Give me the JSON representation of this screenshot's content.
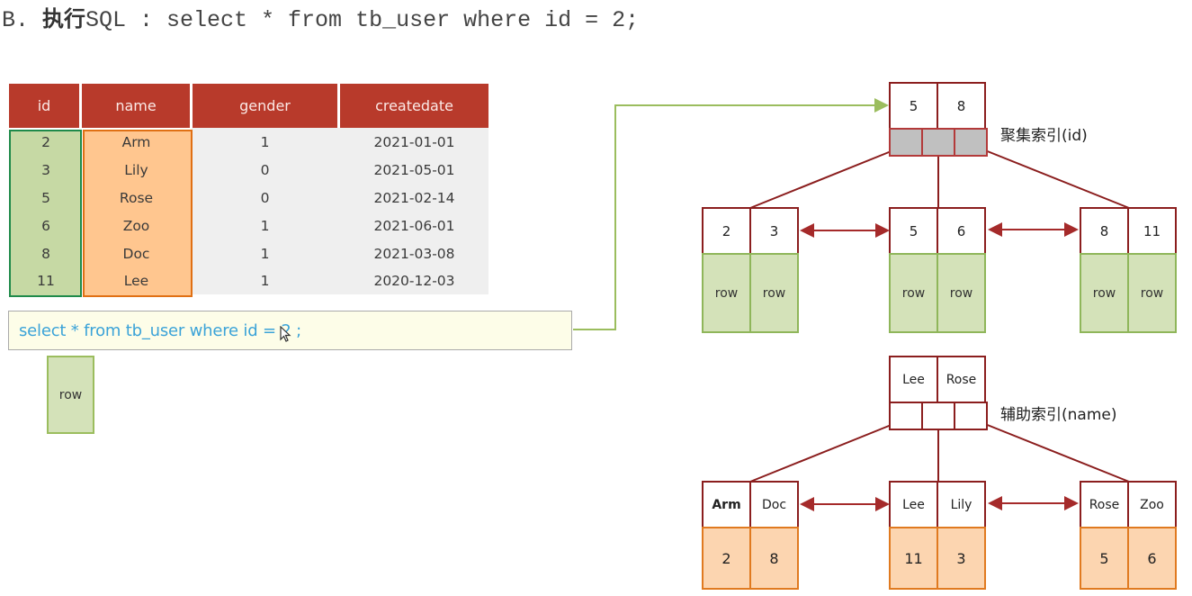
{
  "heading": {
    "prefix": "B. ",
    "cjk": "执行",
    "rest": "SQL : select * from tb_user where id = 2;"
  },
  "table": {
    "columns": [
      "id",
      "name",
      "gender",
      "createdate"
    ],
    "rows": [
      [
        "2",
        "Arm",
        "1",
        "2021-01-01"
      ],
      [
        "3",
        "Lily",
        "0",
        "2021-05-01"
      ],
      [
        "5",
        "Rose",
        "0",
        "2021-02-14"
      ],
      [
        "6",
        "Zoo",
        "1",
        "2021-06-01"
      ],
      [
        "8",
        "Doc",
        "1",
        "2021-03-08"
      ],
      [
        "11",
        "Lee",
        "1",
        "2020-12-03"
      ]
    ]
  },
  "sql_box": {
    "text": "select * from tb_user where id = 2 ;"
  },
  "result_row": {
    "label": "row"
  },
  "clustered_index": {
    "label": "聚集索引(id)",
    "root_keys": [
      "5",
      "8"
    ],
    "leaves": [
      {
        "keys": [
          "2",
          "3"
        ],
        "values": [
          "row",
          "row"
        ]
      },
      {
        "keys": [
          "5",
          "6"
        ],
        "values": [
          "row",
          "row"
        ]
      },
      {
        "keys": [
          "8",
          "11"
        ],
        "values": [
          "row",
          "row"
        ]
      }
    ]
  },
  "secondary_index": {
    "label": "辅助索引(name)",
    "root_keys": [
      "Lee",
      "Rose"
    ],
    "leaves": [
      {
        "keys": [
          "Arm",
          "Doc"
        ],
        "values": [
          "2",
          "8"
        ]
      },
      {
        "keys": [
          "Lee",
          "Lily"
        ],
        "values": [
          "11",
          "3"
        ]
      },
      {
        "keys": [
          "Rose",
          "Zoo"
        ],
        "values": [
          "5",
          "6"
        ]
      }
    ]
  },
  "colors": {
    "header_red": "#b83a2b",
    "tree_line": "#8b1e1e",
    "green_fill": "#d4e2b9",
    "orange_fill": "#fcd5b0",
    "sql_text": "#3ba3d8",
    "arrow_green": "#9bbd5e"
  }
}
